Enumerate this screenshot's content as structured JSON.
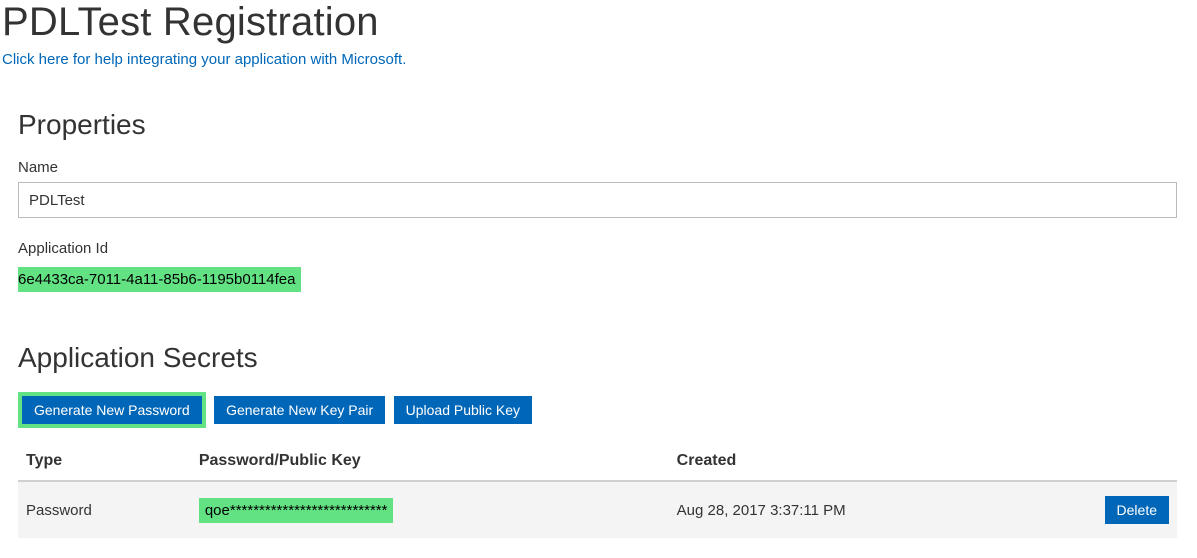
{
  "page": {
    "title": "PDLTest Registration",
    "help_link": "Click here for help integrating your application with Microsoft."
  },
  "properties": {
    "heading": "Properties",
    "name_label": "Name",
    "name_value": "PDLTest",
    "app_id_label": "Application Id",
    "app_id_value": "6e4433ca-7011-4a11-85b6-1195b0114fea"
  },
  "secrets": {
    "heading": "Application Secrets",
    "buttons": {
      "generate_password": "Generate New Password",
      "generate_keypair": "Generate New Key Pair",
      "upload_public_key": "Upload Public Key"
    },
    "columns": {
      "type": "Type",
      "key": "Password/Public Key",
      "created": "Created"
    },
    "rows": [
      {
        "type": "Password",
        "key": "qoe***************************",
        "created": "Aug 28, 2017 3:37:11 PM",
        "delete_label": "Delete"
      }
    ]
  }
}
